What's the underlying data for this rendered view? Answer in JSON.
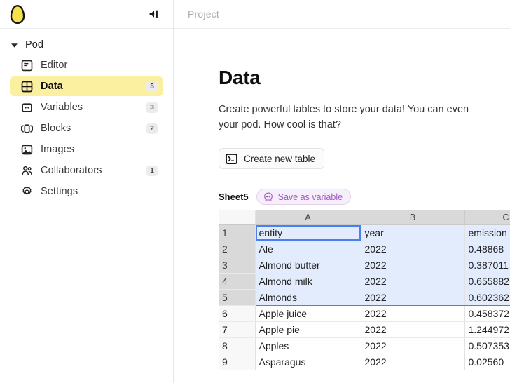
{
  "sidebar": {
    "logo_icon": "egg-logo",
    "logo_color": "#F5E14B",
    "collapse_icon": "collapse-sidebar-icon",
    "tree_root": {
      "label": "Pod",
      "caret_icon": "chevron-down-icon"
    },
    "items": [
      {
        "label": "Editor",
        "icon": "editor-icon",
        "badge": "",
        "active": false
      },
      {
        "label": "Data",
        "icon": "table-grid-icon",
        "badge": "5",
        "active": true
      },
      {
        "label": "Variables",
        "icon": "variables-icon",
        "badge": "3",
        "active": false
      },
      {
        "label": "Blocks",
        "icon": "blocks-icon",
        "badge": "2",
        "active": false
      },
      {
        "label": "Images",
        "icon": "image-icon",
        "badge": "",
        "active": false
      },
      {
        "label": "Collaborators",
        "icon": "collaborators-icon",
        "badge": "1",
        "active": false
      },
      {
        "label": "Settings",
        "icon": "gear-icon",
        "badge": "",
        "active": false
      }
    ],
    "active_highlight_color": "#FBEFA0"
  },
  "topbar": {
    "breadcrumb": "Project"
  },
  "main": {
    "title": "Data",
    "description": "Create powerful tables to store your data! You can even\nyour pod. How cool is that?",
    "create_button": {
      "label": "Create new table",
      "icon": "terminal-icon"
    },
    "sheet_name": "Sheet5",
    "save_variable_button": {
      "label": "Save as variable",
      "icon": "skull-icon",
      "accent_color": "#a05bc4"
    }
  },
  "spreadsheet": {
    "column_headers": [
      "A",
      "B",
      "C"
    ],
    "row_numbers": [
      "1",
      "2",
      "3",
      "4",
      "5",
      "6",
      "7",
      "8",
      "9"
    ],
    "rows": [
      {
        "num": "1",
        "cells": [
          "entity",
          "year",
          "emission"
        ],
        "selected": true,
        "active_cell": 0
      },
      {
        "num": "2",
        "cells": [
          "Ale",
          "2022",
          "0.48868"
        ],
        "selected": true,
        "active_cell": -1
      },
      {
        "num": "3",
        "cells": [
          "Almond butter",
          "2022",
          "0.387011"
        ],
        "selected": true,
        "active_cell": -1
      },
      {
        "num": "4",
        "cells": [
          "Almond milk",
          "2022",
          "0.655882"
        ],
        "selected": true,
        "active_cell": -1
      },
      {
        "num": "5",
        "cells": [
          "Almonds",
          "2022",
          "0.602362"
        ],
        "selected": true,
        "active_cell": -1
      },
      {
        "num": "6",
        "cells": [
          "Apple juice",
          "2022",
          "0.458372"
        ],
        "selected": false,
        "active_cell": -1
      },
      {
        "num": "7",
        "cells": [
          "Apple pie",
          "2022",
          "1.244972"
        ],
        "selected": false,
        "active_cell": -1
      },
      {
        "num": "8",
        "cells": [
          "Apples",
          "2022",
          "0.507353"
        ],
        "selected": false,
        "active_cell": -1
      },
      {
        "num": "9",
        "cells": [
          "Asparagus",
          "2022",
          "0.02560"
        ],
        "selected": false,
        "active_cell": -1
      }
    ],
    "selection_color": "#e3ecfd",
    "selection_border_color": "#4b7ff0"
  }
}
